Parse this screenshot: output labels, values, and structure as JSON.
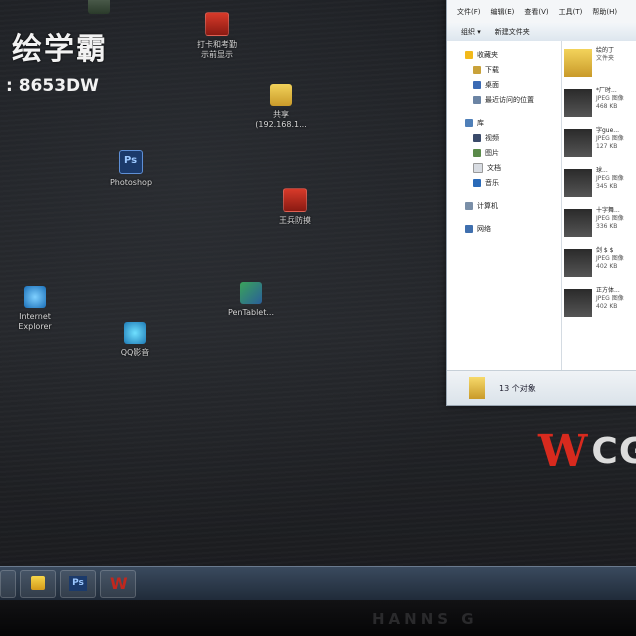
{
  "watermark": {
    "title": "绘学霸",
    "id": ": 8653DW"
  },
  "desktop_icons": [
    {
      "name": "photoshop",
      "label": "Photoshop"
    },
    {
      "name": "shared-folder",
      "label": "共享\n(192.168.1..."
    },
    {
      "name": "game",
      "label": "王兵防摸"
    },
    {
      "name": "ie",
      "label": "Internet\nExplorer"
    },
    {
      "name": "pentablet",
      "label": "PenTablet..."
    },
    {
      "name": "qq",
      "label": "QQ影音"
    },
    {
      "name": "top-app",
      "label": "打卡和考勤\n示前显示"
    }
  ],
  "explorer": {
    "menu": [
      "文件(F)",
      "编辑(E)",
      "查看(V)",
      "工具(T)",
      "帮助(H)"
    ],
    "toolbar": [
      "组织 ▾",
      "新建文件夹"
    ],
    "nav": {
      "favorites": "收藏夹",
      "favorites_items": [
        "下载",
        "桌面",
        "最近访问的位置"
      ],
      "libraries": "库",
      "library_items": [
        "视频",
        "图片",
        "文档",
        "音乐"
      ],
      "computer": "计算机",
      "network": "网络"
    },
    "files": [
      {
        "name": "绘的丁",
        "meta": "文件夹",
        "size": ""
      },
      {
        "name": "*厂时...",
        "meta": "JPEG 图像",
        "size": "468 KB"
      },
      {
        "name": "字gue...",
        "meta": "JPEG 图像",
        "size": "127 KB"
      },
      {
        "name": "球...",
        "meta": "JPEG 图像",
        "size": "345 KB"
      },
      {
        "name": "十字舞...",
        "meta": "JPEG 图像",
        "size": "336 KB"
      },
      {
        "name": "剑 $ $",
        "meta": "JPEG 图像",
        "size": "402 KB"
      },
      {
        "name": "正方体...",
        "meta": "JPEG 图像",
        "size": "402 KB"
      }
    ],
    "status": "13 个对象"
  },
  "logo": {
    "w": "W",
    "cg": "CG"
  },
  "monitor_brand": "HANNS G"
}
